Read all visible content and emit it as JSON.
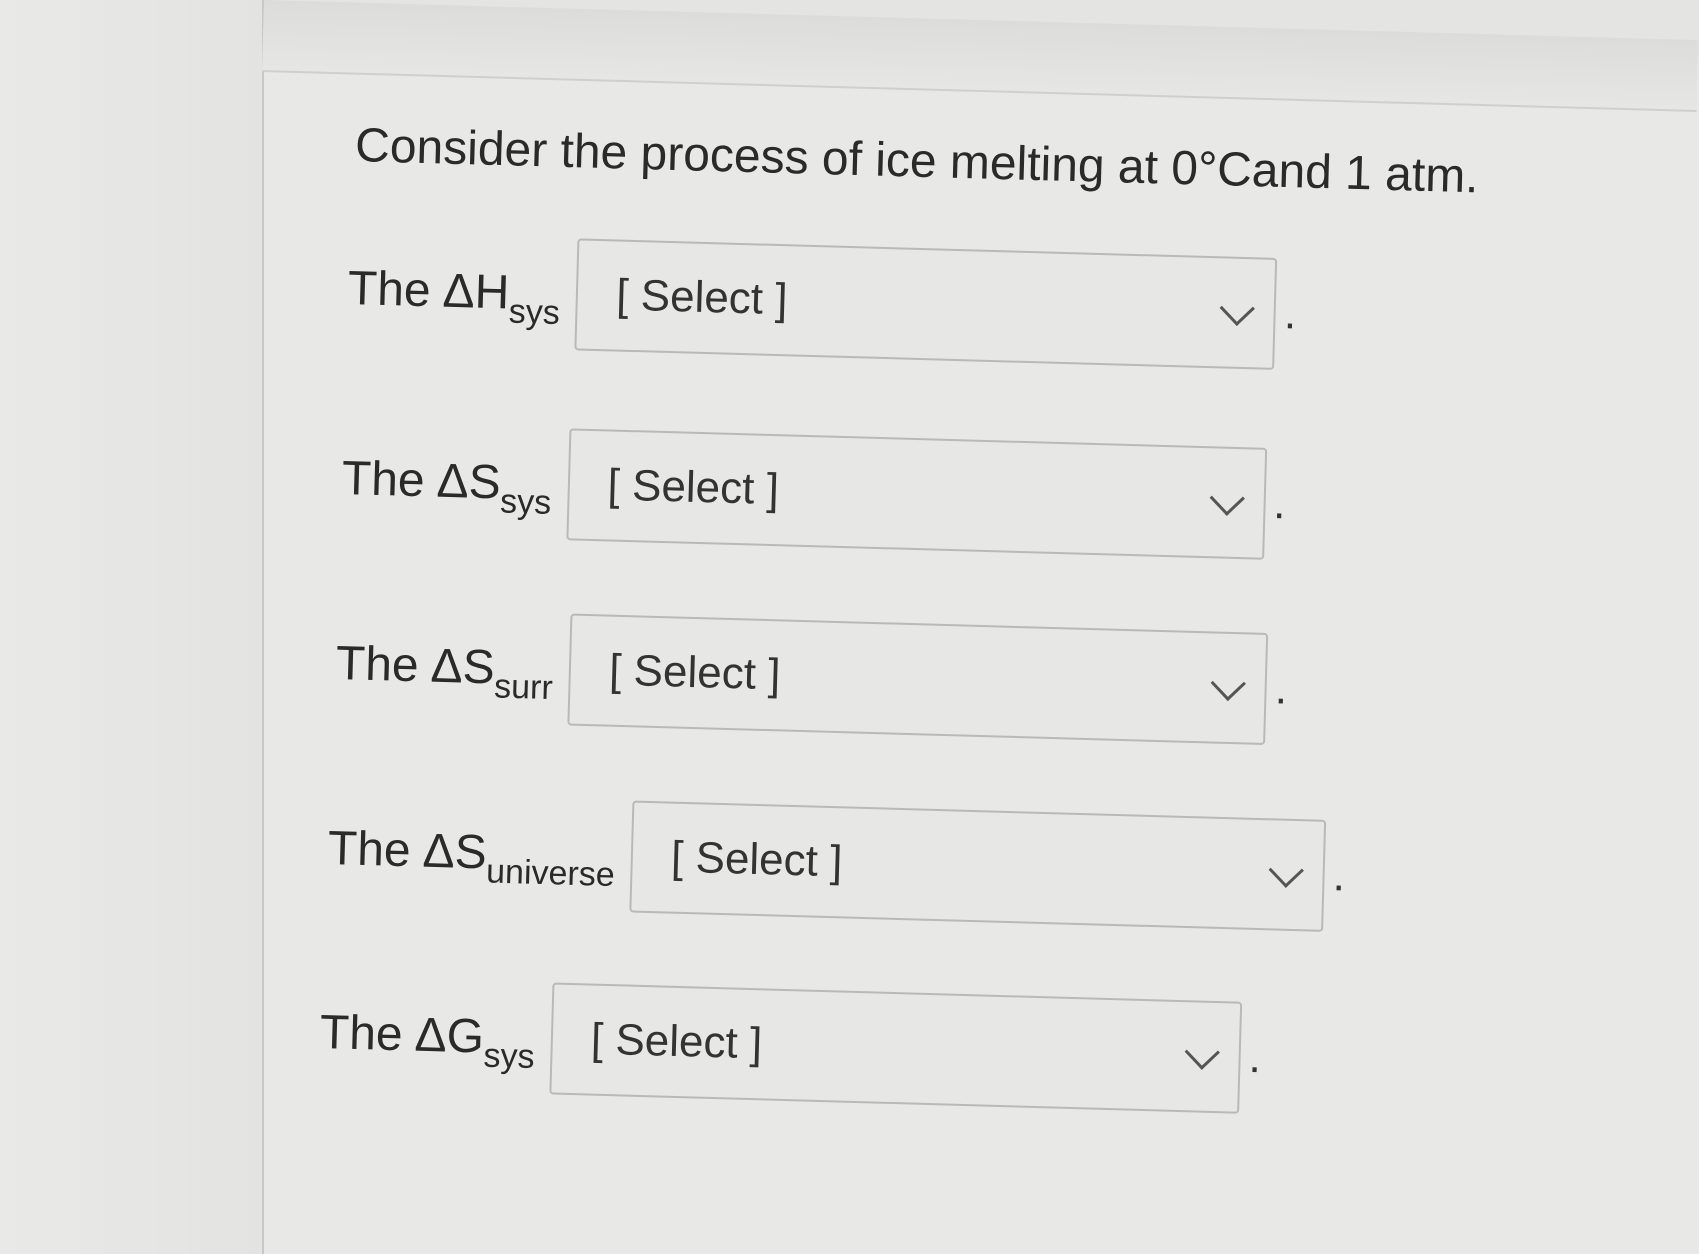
{
  "question": {
    "prefix": "Consider the process of ice melting at 0 ",
    "degree": "°C",
    "suffix": " and 1 atm."
  },
  "rows": [
    {
      "the": "The",
      "symbol": "ΔH",
      "subscript": "sys",
      "value": "[ Select ]",
      "period": "."
    },
    {
      "the": "The",
      "symbol": "ΔS",
      "subscript": "sys",
      "value": "[ Select ]",
      "period": "."
    },
    {
      "the": "The",
      "symbol": "ΔS",
      "subscript": "surr",
      "value": "[ Select ]",
      "period": "."
    },
    {
      "the": "The",
      "symbol": "ΔS",
      "subscript": "universe",
      "value": "[ Select ]",
      "period": "."
    },
    {
      "the": "The",
      "symbol": "ΔG",
      "subscript": "sys",
      "value": "[ Select ]",
      "period": "."
    }
  ]
}
